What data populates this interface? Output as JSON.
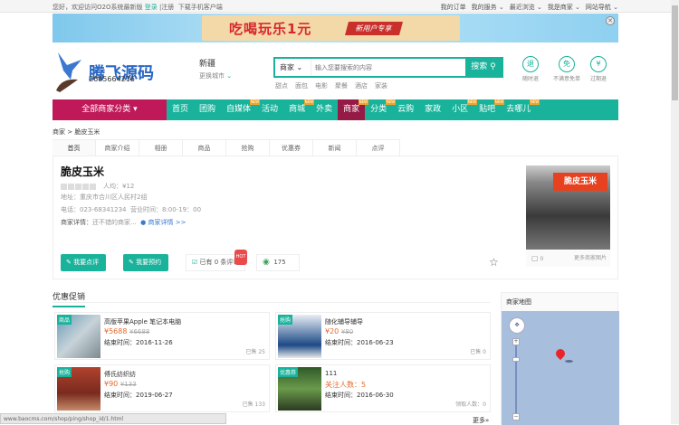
{
  "topbar": {
    "welcome": "您好，欢迎访问O2O系统最新版",
    "login": "登录",
    "register": "|注册",
    "app": "下载手机客户端",
    "links": [
      "我的订单",
      "我的服务 ⌄",
      "最近浏览 ⌄",
      "我是商家 ⌄",
      "网站导航 ⌄"
    ]
  },
  "banner": {
    "title": "吃喝玩乐1元",
    "sub": "新用户专享"
  },
  "logo": {
    "name": "腾飞源码",
    "tel": "2685664216"
  },
  "city": {
    "name": "新疆",
    "change": "更换城市"
  },
  "search": {
    "category": "商家 ⌄",
    "placeholder": "输入您要搜索的内容",
    "button": "搜索",
    "hot": [
      "甜点",
      "面包",
      "电影",
      "聚餐",
      "酒店",
      "家装"
    ]
  },
  "features": [
    {
      "icon": "退",
      "label": "随时退"
    },
    {
      "icon": "免",
      "label": "不满意免单"
    },
    {
      "icon": "¥",
      "label": "过期退"
    }
  ],
  "nav": {
    "all": "全部商家分类 ▾",
    "items": [
      {
        "label": "首页",
        "new": false
      },
      {
        "label": "团购",
        "new": false
      },
      {
        "label": "自媒体",
        "new": true
      },
      {
        "label": "活动",
        "new": false
      },
      {
        "label": "商城",
        "new": true
      },
      {
        "label": "外卖",
        "new": false
      },
      {
        "label": "商家",
        "new": true,
        "active": true
      },
      {
        "label": "分类",
        "new": true
      },
      {
        "label": "云购",
        "new": false
      },
      {
        "label": "家政",
        "new": false
      },
      {
        "label": "小区",
        "new": true
      },
      {
        "label": "贴吧",
        "new": true
      },
      {
        "label": "去哪儿",
        "new": true
      }
    ],
    "new_label": "NEW"
  },
  "breadcrumb": "商家 > 脆皮玉米",
  "tabs": [
    "首页",
    "商家介绍",
    "相册",
    "商品",
    "抢购",
    "优惠券",
    "新闻",
    "点评"
  ],
  "shop": {
    "name": "脆皮玉米",
    "avg": "人均：¥12",
    "address": "地址：重庆市合川区人民村2组",
    "phone": "电话：023-68341234",
    "hours": "营业时间：8:00-19：00",
    "detail_label": "商家详情：",
    "detail": "还不错的商家...",
    "detail_link": "商家详情 >>",
    "btn_review": "我要点评",
    "btn_book": "我要预约",
    "comments": "已有 0 条评论",
    "hot": "HOT",
    "views": "175",
    "photo_count": "0",
    "more_photos": "更多商家图片",
    "sign": "脆皮玉米"
  },
  "promo": {
    "title": "优惠促销",
    "more": "更多»",
    "items": [
      {
        "tag": "商品",
        "name": "高版苹果Apple 笔记本电脑",
        "price": "¥5688",
        "old": "¥6688",
        "end": "结束时间：2016-11-26",
        "sold": "已售 25"
      },
      {
        "tag": "抢购",
        "name": "随化辅导辅导",
        "price": "¥20",
        "old": "¥80",
        "end": "结束时间：2016-06-23",
        "sold": "已售 0"
      },
      {
        "tag": "抢购",
        "name": "傅氏纺织纺",
        "price": "¥90",
        "old": "¥133",
        "end": "结束时间：2019-06-27",
        "sold": "已售 133"
      },
      {
        "tag": "优惠券",
        "name": "111",
        "price": "关注人数：5",
        "old": "",
        "end": "结束时间：2016-06-30",
        "sold": "领取人数：0"
      }
    ]
  },
  "map": {
    "title": "商家地图"
  },
  "status": "www.baocms.com/shop/ping/shop_id/1.html"
}
